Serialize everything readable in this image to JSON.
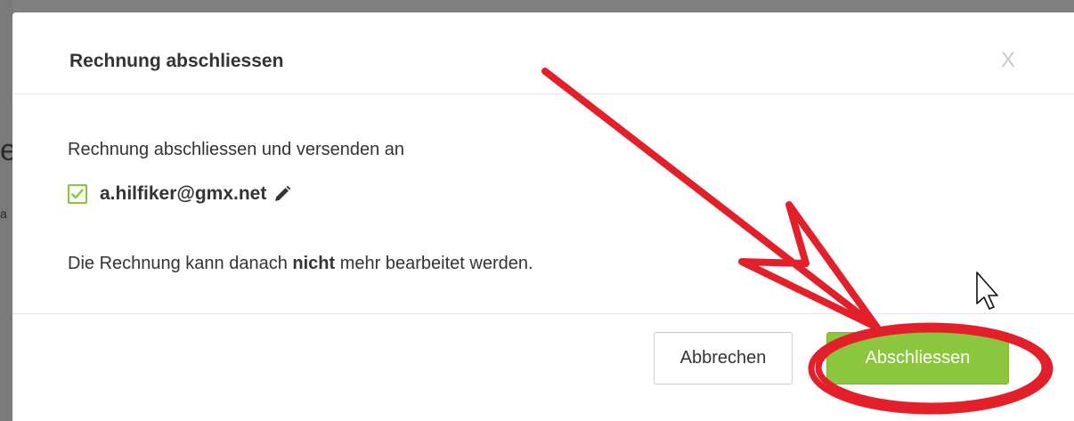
{
  "dialog": {
    "title": "Rechnung abschliessen",
    "close_label": "X",
    "intro_text": "Rechnung abschliessen und versenden an",
    "recipient": {
      "email": "a.hilfiker@gmx.net",
      "checked": true,
      "edit_icon": "pencil-icon"
    },
    "note": {
      "before": "Die Rechnung kann danach ",
      "emphasis": "nicht",
      "after": " mehr bearbeitet werden."
    },
    "buttons": {
      "cancel_label": "Abbrechen",
      "confirm_label": "Abschliessen"
    }
  },
  "annotation": {
    "arrow_color": "#e3202a",
    "highlight_target": "confirm-button"
  },
  "colors": {
    "confirm_green": "#8cc63f",
    "checkbox_green": "#8cc04b",
    "backdrop": "#808080"
  },
  "backdrop_fragments": [
    "e",
    "a"
  ]
}
